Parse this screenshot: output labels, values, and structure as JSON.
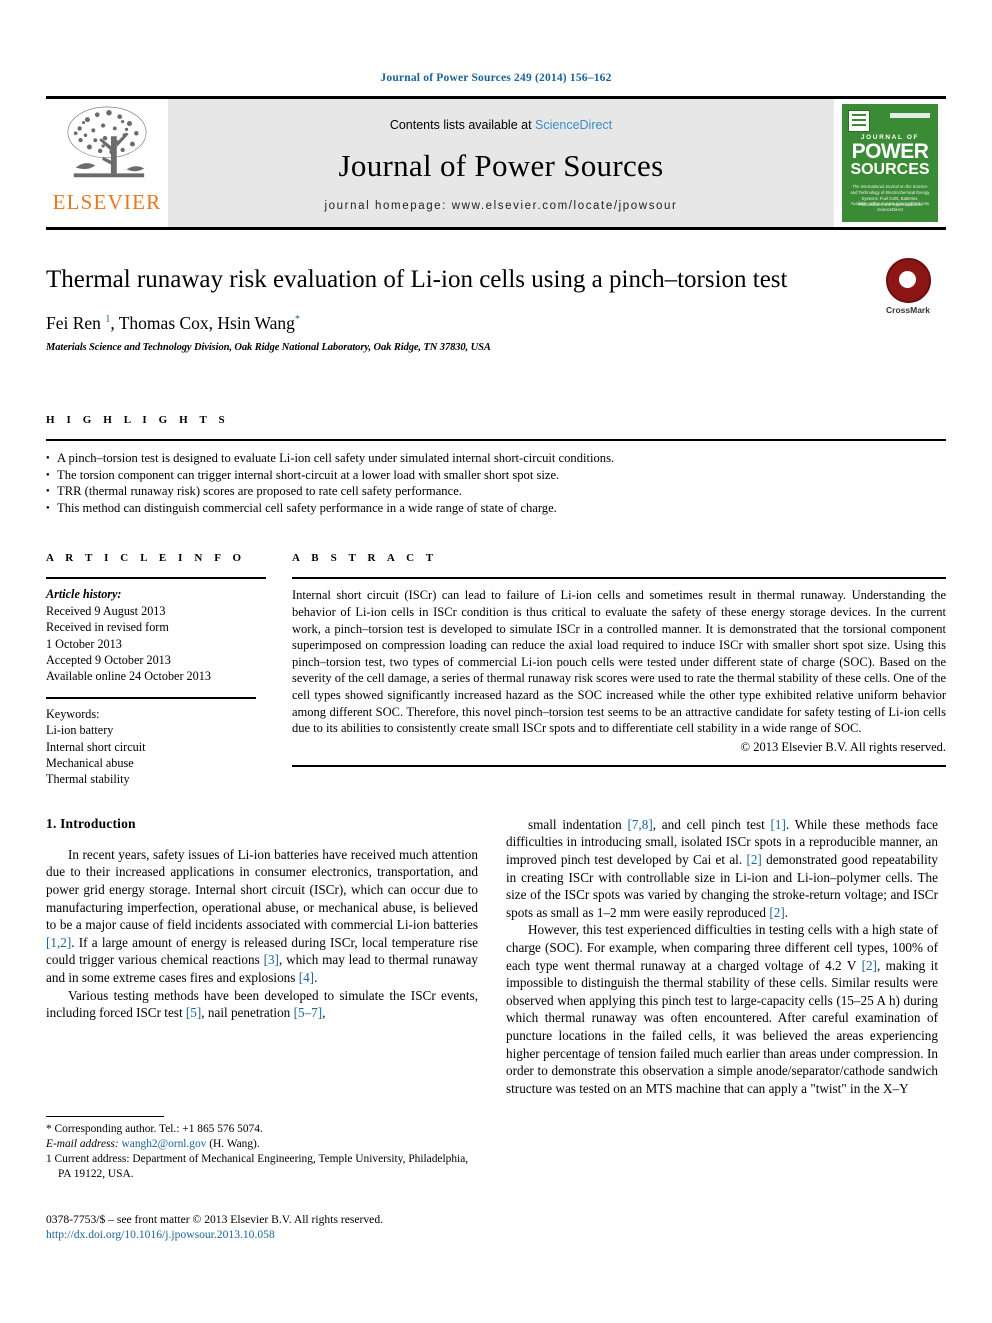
{
  "running_head": "Journal of Power Sources 249 (2014) 156–162",
  "masthead": {
    "contents_prefix": "Contents lists available at",
    "sciencedirect": "ScienceDirect",
    "journal_name": "Journal of Power Sources",
    "homepage": "journal homepage: www.elsevier.com/locate/jpowsour",
    "publisher_wordmark": "ELSEVIER",
    "cover": {
      "journal_of": "JOURNAL OF",
      "power": "POWER",
      "sources": "SOURCES",
      "subtitle": "The International Journal on the Science and Technology of Electrochemical Energy Systems: Fuel Cells, Batteries, Photovoltaics and Supercapacitors",
      "footer": "Available online at www.sciencedirect.com ScienceDirect"
    },
    "colors": {
      "band": "#e7e7e7",
      "link": "#3a8ec6",
      "elsevier_orange": "#e87722",
      "cover_green": "#3b8a35"
    }
  },
  "article": {
    "title": "Thermal runaway risk evaluation of Li-ion cells using a pinch–torsion test",
    "authors_html": "Fei Ren <sup>1</sup>, Thomas Cox, Hsin Wang<sup>*</sup>",
    "affiliation": "Materials Science and Technology Division, Oak Ridge National Laboratory, Oak Ridge, TN 37830, USA",
    "crossmark_label": "CrossMark"
  },
  "highlights": {
    "heading": "H I G H L I G H T S",
    "items": [
      "A pinch–torsion test is designed to evaluate Li-ion cell safety under simulated internal short-circuit conditions.",
      "The torsion component can trigger internal short-circuit at a lower load with smaller short spot size.",
      "TRR (thermal runaway risk) scores are proposed to rate cell safety performance.",
      "This method can distinguish commercial cell safety performance in a wide range of state of charge."
    ]
  },
  "article_info": {
    "heading": "A R T I C L E   I N F O",
    "history_label": "Article history:",
    "history": [
      "Received 9 August 2013",
      "Received in revised form",
      "1 October 2013",
      "Accepted 9 October 2013",
      "Available online 24 October 2013"
    ],
    "keywords_label": "Keywords:",
    "keywords": [
      "Li-ion battery",
      "Internal short circuit",
      "Mechanical abuse",
      "Thermal stability"
    ]
  },
  "abstract": {
    "heading": "A B S T R A C T",
    "text": "Internal short circuit (ISCr) can lead to failure of Li-ion cells and sometimes result in thermal runaway. Understanding the behavior of Li-ion cells in ISCr condition is thus critical to evaluate the safety of these energy storage devices. In the current work, a pinch–torsion test is developed to simulate ISCr in a controlled manner. It is demonstrated that the torsional component superimposed on compression loading can reduce the axial load required to induce ISCr with smaller short spot size. Using this pinch–torsion test, two types of commercial Li-ion pouch cells were tested under different state of charge (SOC). Based on the severity of the cell damage, a series of thermal runaway risk scores were used to rate the thermal stability of these cells. One of the cell types showed significantly increased hazard as the SOC increased while the other type exhibited relative uniform behavior among different SOC. Therefore, this novel pinch–torsion test seems to be an attractive candidate for safety testing of Li-ion cells due to its abilities to consistently create small ISCr spots and to differentiate cell stability in a wide range of SOC.",
    "copyright": "© 2013 Elsevier B.V. All rights reserved."
  },
  "body": {
    "section_heading": "1.  Introduction",
    "left_paragraphs": [
      "In recent years, safety issues of Li-ion batteries have received much attention due to their increased applications in consumer electronics, transportation, and power grid energy storage. Internal short circuit (ISCr), which can occur due to manufacturing imperfection, operational abuse, or mechanical abuse, is believed to be a major cause of field incidents associated with commercial Li-ion batteries [1,2]. If a large amount of energy is released during ISCr, local temperature rise could trigger various chemical reactions [3], which may lead to thermal runaway and in some extreme cases fires and explosions [4].",
      "Various testing methods have been developed to simulate the ISCr events, including forced ISCr test [5], nail penetration [5–7],"
    ],
    "right_paragraphs": [
      "small indentation [7,8], and cell pinch test [1]. While these methods face difficulties in introducing small, isolated ISCr spots in a reproducible manner, an improved pinch test developed by Cai et al. [2] demonstrated good repeatability in creating ISCr with controllable size in Li-ion and Li-ion–polymer cells. The size of the ISCr spots was varied by changing the stroke-return voltage; and ISCr spots as small as 1–2 mm were easily reproduced [2].",
      "However, this test experienced difficulties in testing cells with a high state of charge (SOC). For example, when comparing three different cell types, 100% of each type went thermal runaway at a charged voltage of 4.2 V [2], making it impossible to distinguish the thermal stability of these cells. Similar results were observed when applying this pinch test to large-capacity cells (15–25 A h) during which thermal runaway was often encountered. After careful examination of puncture locations in the failed cells, it was believed the areas experiencing higher percentage of tension failed much earlier than areas under compression. In order to demonstrate this observation a simple anode/separator/cathode sandwich structure was tested on an MTS machine that can apply a \"twist\" in the X–Y"
    ]
  },
  "footnotes": {
    "corresponding": "* Corresponding author. Tel.: +1 865 576 5074.",
    "email_label": "E-mail address:",
    "email": "wangh2@ornl.gov",
    "email_suffix": "(H. Wang).",
    "current_address": "1  Current address: Department of Mechanical Engineering, Temple University, Philadelphia, PA 19122, USA.",
    "issn_line": "0378-7753/$ – see front matter © 2013 Elsevier B.V. All rights reserved.",
    "doi": "http://dx.doi.org/10.1016/j.jpowsour.2013.10.058"
  }
}
